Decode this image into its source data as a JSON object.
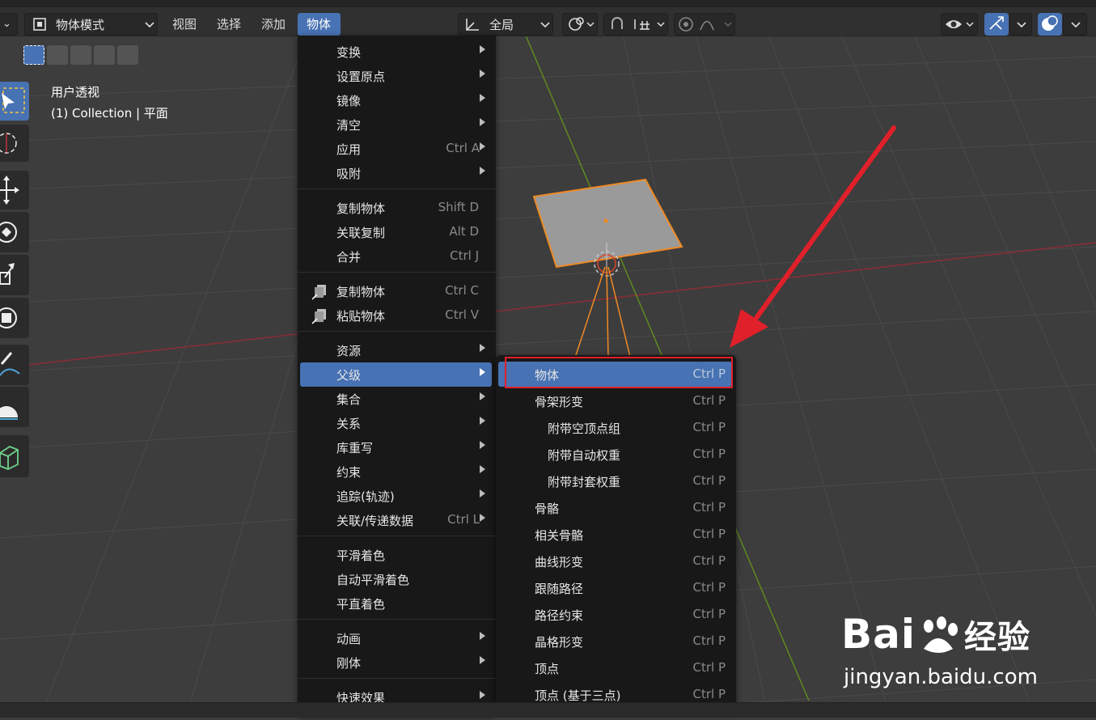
{
  "header": {
    "mode_label": "物体模式",
    "menu_items": [
      "视图",
      "选择",
      "添加",
      "物体"
    ],
    "transform_orientation": "全局"
  },
  "viewport": {
    "view_name": "用户透视",
    "collection_info": "(1) Collection | 平面"
  },
  "object_menu": {
    "groups": [
      [
        {
          "label": "变换",
          "shortcut": "",
          "submenu": true
        },
        {
          "label": "设置原点",
          "shortcut": "",
          "submenu": true
        },
        {
          "label": "镜像",
          "shortcut": "",
          "submenu": true
        },
        {
          "label": "清空",
          "shortcut": "",
          "submenu": true
        },
        {
          "label": "应用",
          "shortcut": "Ctrl A",
          "submenu": true
        },
        {
          "label": "吸附",
          "shortcut": "",
          "submenu": true
        }
      ],
      [
        {
          "label": "复制物体",
          "shortcut": "Shift D",
          "submenu": false
        },
        {
          "label": "关联复制",
          "shortcut": "Alt D",
          "submenu": false
        },
        {
          "label": "合并",
          "shortcut": "Ctrl J",
          "submenu": false
        }
      ],
      [
        {
          "label": "复制物体",
          "shortcut": "Ctrl C",
          "submenu": false,
          "icon": "copy-icon"
        },
        {
          "label": "粘贴物体",
          "shortcut": "Ctrl V",
          "submenu": false,
          "icon": "paste-icon"
        }
      ],
      [
        {
          "label": "资源",
          "shortcut": "",
          "submenu": true
        },
        {
          "label": "父级",
          "shortcut": "",
          "submenu": true,
          "highlighted": true
        },
        {
          "label": "集合",
          "shortcut": "",
          "submenu": true
        },
        {
          "label": "关系",
          "shortcut": "",
          "submenu": true
        },
        {
          "label": "库重写",
          "shortcut": "",
          "submenu": true
        },
        {
          "label": "约束",
          "shortcut": "",
          "submenu": true
        },
        {
          "label": "追踪(轨迹)",
          "shortcut": "",
          "submenu": true
        },
        {
          "label": "关联/传递数据",
          "shortcut": "Ctrl L",
          "submenu": true
        }
      ],
      [
        {
          "label": "平滑着色",
          "shortcut": "",
          "submenu": false
        },
        {
          "label": "自动平滑着色",
          "shortcut": "",
          "submenu": false
        },
        {
          "label": "平直着色",
          "shortcut": "",
          "submenu": false
        }
      ],
      [
        {
          "label": "动画",
          "shortcut": "",
          "submenu": true
        },
        {
          "label": "刚体",
          "shortcut": "",
          "submenu": true
        }
      ],
      [
        {
          "label": "快速效果",
          "shortcut": "",
          "submenu": true
        }
      ]
    ]
  },
  "parent_submenu": {
    "items": [
      {
        "label": "物体",
        "shortcut": "Ctrl P",
        "indent": false,
        "highlighted": true
      },
      {
        "label": "骨架形变",
        "shortcut": "Ctrl P",
        "indent": false
      },
      {
        "label": "附带空顶点组",
        "shortcut": "Ctrl P",
        "indent": true
      },
      {
        "label": "附带自动权重",
        "shortcut": "Ctrl P",
        "indent": true
      },
      {
        "label": "附带封套权重",
        "shortcut": "Ctrl P",
        "indent": true
      },
      {
        "label": "骨骼",
        "shortcut": "Ctrl P",
        "indent": false
      },
      {
        "label": "相关骨骼",
        "shortcut": "Ctrl P",
        "indent": false
      },
      {
        "label": "曲线形变",
        "shortcut": "Ctrl P",
        "indent": false
      },
      {
        "label": "跟随路径",
        "shortcut": "Ctrl P",
        "indent": false
      },
      {
        "label": "路径约束",
        "shortcut": "Ctrl P",
        "indent": false
      },
      {
        "label": "晶格形变",
        "shortcut": "Ctrl P",
        "indent": false
      },
      {
        "label": "顶点",
        "shortcut": "Ctrl P",
        "indent": false
      },
      {
        "label": "顶点 (基于三点)",
        "shortcut": "Ctrl P",
        "indent": false
      }
    ]
  },
  "watermark": {
    "brand": "Bai",
    "brand_suffix": "经验",
    "url": "jingyan.baidu.com"
  },
  "colors": {
    "accent": "#4772b3",
    "annotation_red": "#e0202a",
    "selection_orange": "#f08a24"
  }
}
